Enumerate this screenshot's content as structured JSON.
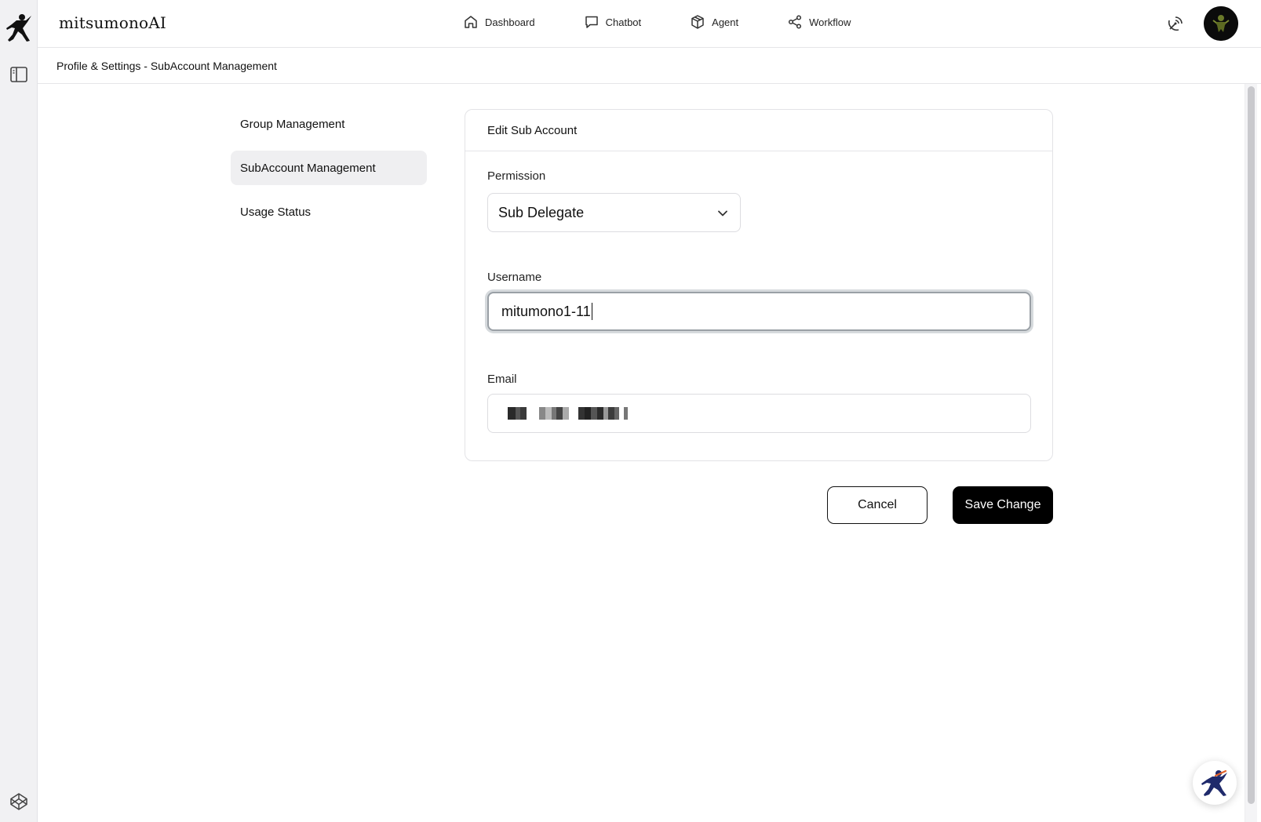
{
  "app": {
    "brand": "mitsumonoAI"
  },
  "nav": {
    "items": [
      {
        "label": "Dashboard",
        "icon": "home-icon"
      },
      {
        "label": "Chatbot",
        "icon": "chat-bubble-icon"
      },
      {
        "label": "Agent",
        "icon": "cube-icon"
      },
      {
        "label": "Workflow",
        "icon": "share-nodes-icon"
      }
    ]
  },
  "breadcrumb": "Profile & Settings - SubAccount Management",
  "settings_menu": {
    "items": [
      {
        "label": "Group Management",
        "active": false
      },
      {
        "label": "SubAccount Management",
        "active": true
      },
      {
        "label": "Usage Status",
        "active": false
      }
    ]
  },
  "card": {
    "title": "Edit Sub Account",
    "permission": {
      "label": "Permission",
      "value": "Sub Delegate"
    },
    "username": {
      "label": "Username",
      "value": "mitumono1-11"
    },
    "email": {
      "label": "Email",
      "value_redacted": true
    }
  },
  "actions": {
    "cancel_label": "Cancel",
    "save_label": "Save Change"
  },
  "colors": {
    "accent": "#000000",
    "rail_bg": "#f1f1f3",
    "active_menu_bg": "#efeff1",
    "fab_figure": "#1f2a6b",
    "fab_accent": "#e2622a"
  }
}
